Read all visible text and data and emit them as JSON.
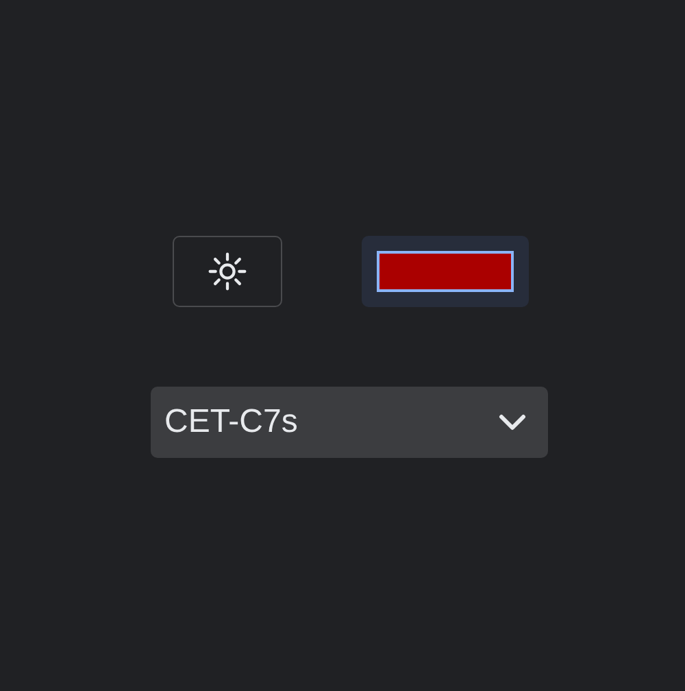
{
  "color_swatch": {
    "color": "#aa0000"
  },
  "colormap_select": {
    "value": "CET-C7s"
  }
}
